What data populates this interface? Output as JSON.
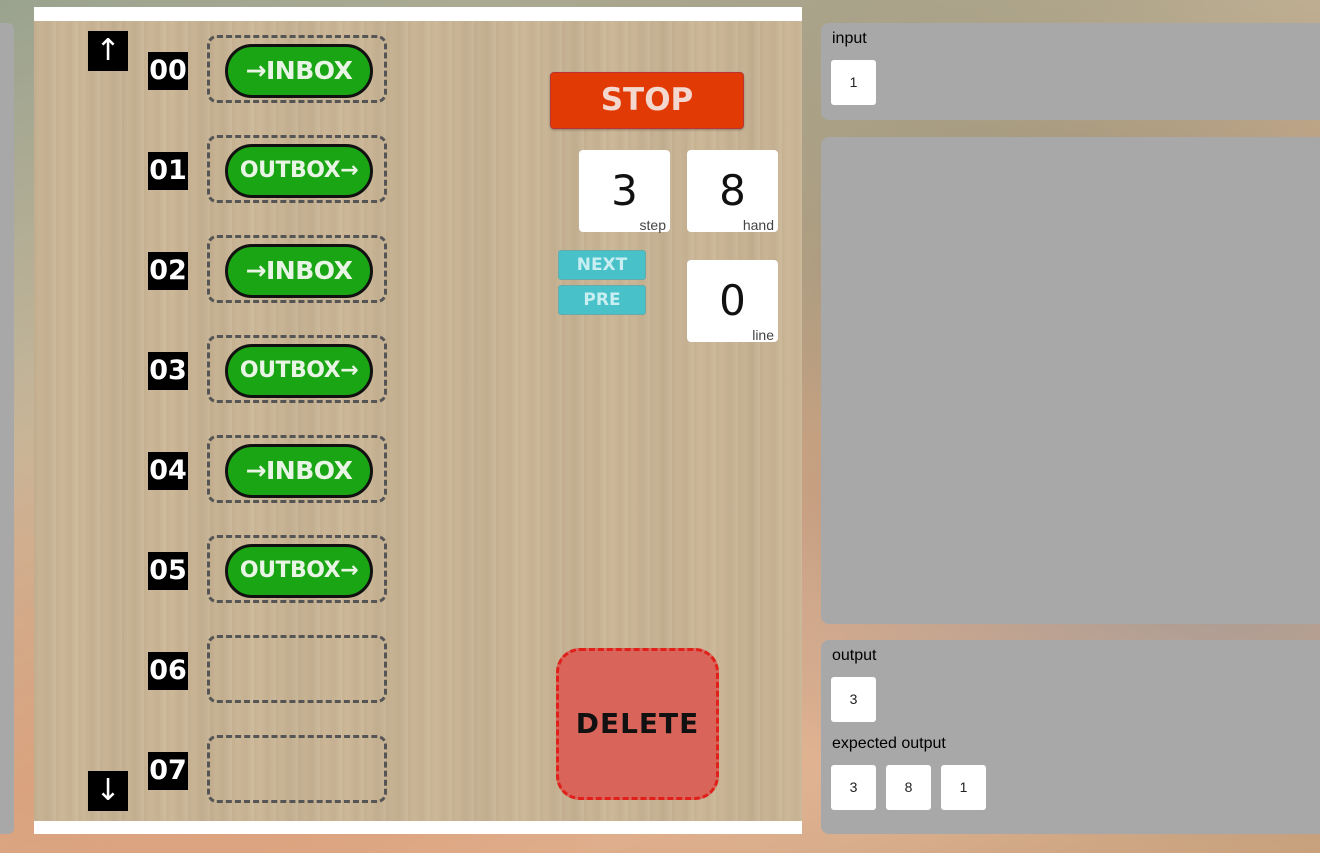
{
  "nav": {
    "up_arrow": "↑",
    "down_arrow": "↓"
  },
  "program": {
    "rows": [
      {
        "num": "00",
        "cmd": "→INBOX"
      },
      {
        "num": "01",
        "cmd": "OUTBOX→"
      },
      {
        "num": "02",
        "cmd": "→INBOX"
      },
      {
        "num": "03",
        "cmd": "OUTBOX→"
      },
      {
        "num": "04",
        "cmd": "→INBOX"
      },
      {
        "num": "05",
        "cmd": "OUTBOX→"
      },
      {
        "num": "06",
        "cmd": ""
      },
      {
        "num": "07",
        "cmd": ""
      }
    ]
  },
  "controls": {
    "stop_label": "STOP",
    "next_label": "NEXT",
    "pre_label": "PRE",
    "delete_label": "DELETE"
  },
  "counters": {
    "step": {
      "value": "3",
      "label": "step"
    },
    "hand": {
      "value": "8",
      "label": "hand"
    },
    "line": {
      "value": "0",
      "label": "line"
    }
  },
  "input_panel": {
    "title": "input",
    "items": [
      "1"
    ]
  },
  "output_panel": {
    "title": "output",
    "items": [
      "3"
    ],
    "expected_title": "expected output",
    "expected_items": [
      "3",
      "8",
      "1"
    ]
  },
  "colors": {
    "command_green": "#1aa514",
    "stop_red": "#e13a05",
    "nav_cyan": "#49c1c9",
    "delete_red": "#d8645a",
    "panel_gray": "#a8a8a8"
  },
  "icons": {
    "up": "up-arrow-icon",
    "down": "down-arrow-icon"
  }
}
